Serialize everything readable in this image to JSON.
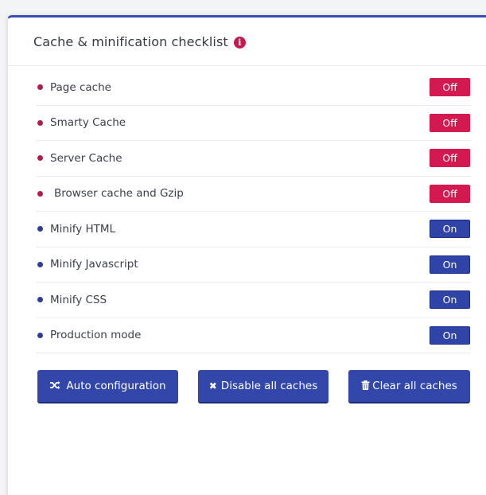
{
  "panel": {
    "title": "Cache & minification checklist",
    "info_icon": "info-icon",
    "info_color": "#c41a4e"
  },
  "items": [
    {
      "label": "Page cache",
      "state": "Off",
      "status": "off"
    },
    {
      "label": "Smarty Cache",
      "state": "Off",
      "status": "off"
    },
    {
      "label": "Server Cache",
      "state": "Off",
      "status": "off"
    },
    {
      "label": "Browser cache and Gzip",
      "state": "Off",
      "status": "off"
    },
    {
      "label": "Minify HTML",
      "state": "On",
      "status": "on"
    },
    {
      "label": "Minify Javascript",
      "state": "On",
      "status": "on"
    },
    {
      "label": "Minify CSS",
      "state": "On",
      "status": "on"
    },
    {
      "label": "Production mode",
      "state": "On",
      "status": "on"
    }
  ],
  "actions": {
    "auto_config": {
      "label": "Auto configuration",
      "icon": "shuffle-icon"
    },
    "disable_all": {
      "label": "Disable all caches",
      "icon": "close-icon"
    },
    "clear_all": {
      "label": "Clear all caches",
      "icon": "trash-icon"
    }
  },
  "colors": {
    "off_badge": "#d3194f",
    "on_badge": "#2f44a6",
    "button": "#3347ab",
    "card_accent": "#3b4cb8"
  }
}
